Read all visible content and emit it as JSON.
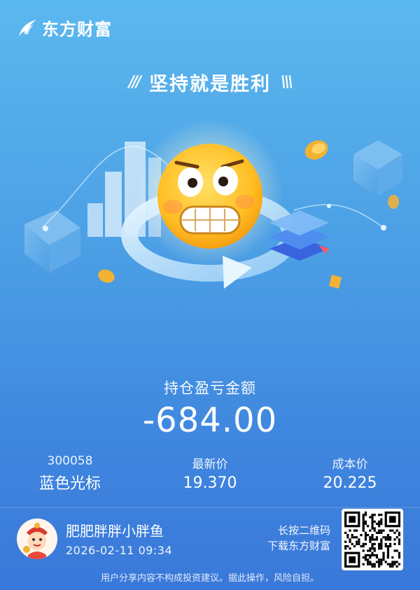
{
  "brand": {
    "name": "东方财富"
  },
  "slogan": {
    "text": "坚持就是胜利",
    "deco_left": "///",
    "deco_right": "\\\\\\"
  },
  "pnl": {
    "label": "持仓盈亏金额",
    "value": "-684.00"
  },
  "stock": {
    "code": "300058",
    "name": "蓝色光标",
    "latest_price_label": "最新价",
    "latest_price": "19.370",
    "cost_price_label": "成本价",
    "cost_price": "20.225"
  },
  "user": {
    "nickname": "肥肥胖胖小胖鱼",
    "timestamp": "2026-02-11 09:34"
  },
  "download": {
    "line1": "长按二维码",
    "line2": "下载东方财富"
  },
  "disclaimer": "用户分享内容不构成投资建议。据此操作，风险自担。",
  "colors": {
    "bg_top": "#5bb8ee",
    "bg_bottom": "#3a78d9",
    "text": "#ffffff",
    "emoji_yellow": "#ffc12a",
    "coin_gold": "#f3b233",
    "logo_red": "#e8392c"
  },
  "icons": [
    "brand-logo-icon",
    "worried-face-icon",
    "refresh-ring-icon",
    "bar-chart-icon",
    "layers-icon",
    "coin-icon",
    "cube-icon",
    "avatar-icon",
    "qr-code-icon"
  ]
}
